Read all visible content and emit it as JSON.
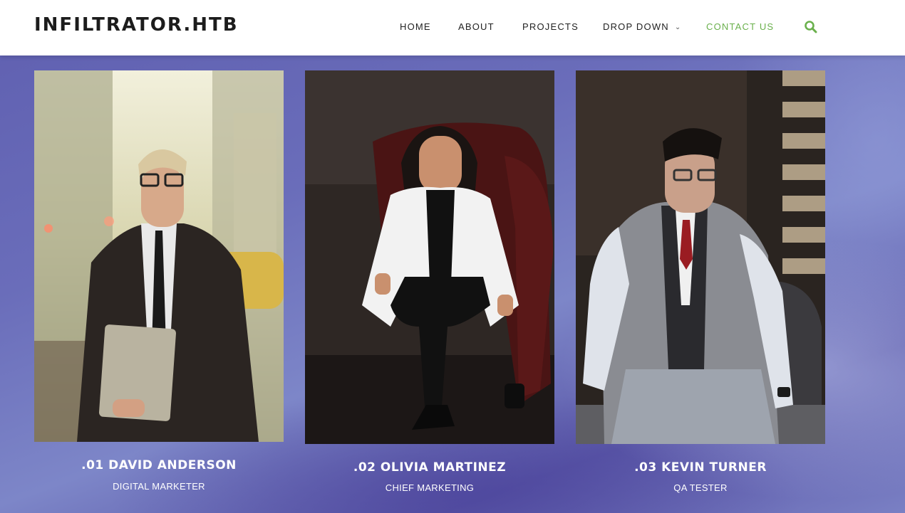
{
  "site": {
    "logo": "INFILTRATOR.HTB"
  },
  "nav": {
    "home": "HOME",
    "about": "ABOUT",
    "projects": "PROJECTS",
    "dropdown": "DROP DOWN",
    "contact": "CONTACT US",
    "search_icon": "search-icon"
  },
  "colors": {
    "accent": "#6ab04c",
    "background": "#6a6dba",
    "header": "#ffffff"
  },
  "team": [
    {
      "name": ".01 DAVID ANDERSON",
      "role": "DIGITAL MARKETER"
    },
    {
      "name": ".02 OLIVIA MARTINEZ",
      "role": "CHIEF MARKETING"
    },
    {
      "name": ".03 KEVIN TURNER",
      "role": "QA TESTER"
    }
  ]
}
